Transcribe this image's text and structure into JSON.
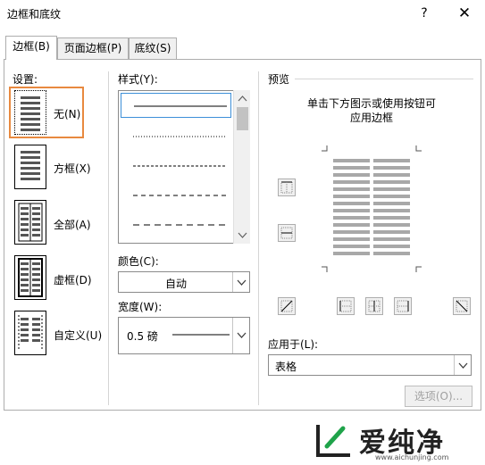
{
  "window": {
    "title": "边框和底纹",
    "help": "?",
    "close": "✕"
  },
  "tabs": [
    {
      "label": "边框(B)",
      "active": true
    },
    {
      "label": "页面边框(P)",
      "active": false
    },
    {
      "label": "底纹(S)",
      "active": false
    }
  ],
  "settings": {
    "label": "设置:",
    "items": [
      {
        "label": "无(N)",
        "icon": "none-border-icon",
        "selected": true
      },
      {
        "label": "方框(X)",
        "icon": "box-border-icon",
        "selected": false
      },
      {
        "label": "全部(A)",
        "icon": "all-border-icon",
        "selected": false
      },
      {
        "label": "虚框(D)",
        "icon": "grid-border-icon",
        "selected": false
      },
      {
        "label": "自定义(U)",
        "icon": "custom-border-icon",
        "selected": false
      }
    ]
  },
  "style": {
    "label": "样式(Y):",
    "items": [
      "solid",
      "dotted",
      "dash-dot",
      "dashed",
      "long-dashed"
    ]
  },
  "color": {
    "label": "颜色(C):",
    "value": "自动"
  },
  "width": {
    "label": "宽度(W):",
    "value": "0.5 磅"
  },
  "preview": {
    "label": "预览",
    "hint_line1": "单击下方图示或使用按钮可",
    "hint_line2": "应用边框"
  },
  "apply_to": {
    "label": "应用于(L):",
    "value": "表格"
  },
  "options_button": "选项(O)...",
  "watermark": {
    "brand": "爱纯净",
    "url": "www.aichunjing.com"
  },
  "colors": {
    "accent": "#e8893f",
    "selection": "#3c8fd8",
    "brand_green": "#1fa34a"
  }
}
